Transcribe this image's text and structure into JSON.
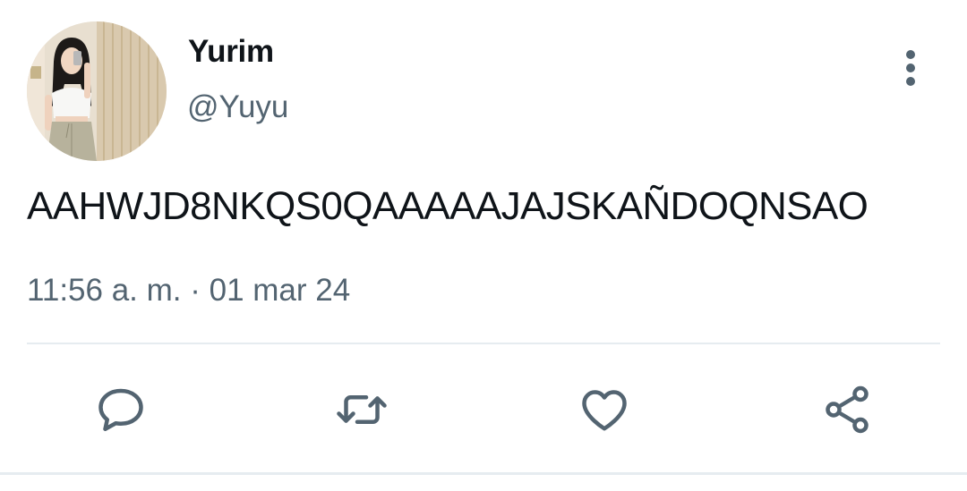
{
  "tweet": {
    "display_name": "Yurim",
    "handle": "@Yuyu",
    "text": "AAHWJD8NKQS0QAAAAAJAJSKAÑDOQNSAO",
    "time": "11:56 a. m.",
    "separator": " · ",
    "date": "01 mar 24"
  },
  "icons": {
    "more": "more-vertical-icon",
    "reply": "reply-icon",
    "retweet": "retweet-icon",
    "like": "heart-icon",
    "share": "share-icon"
  },
  "colors": {
    "text": "#0f1419",
    "secondary": "#536471",
    "divider": "#e6ecf0"
  }
}
